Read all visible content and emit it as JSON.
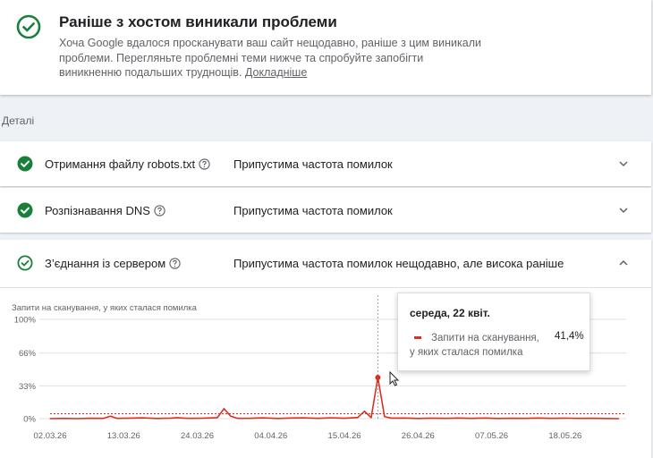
{
  "banner": {
    "title": "Раніше з хостом виникали проблеми",
    "text": "Хоча Google вдалося просканувати ваш сайт нещодавно, раніше з цим виникали проблеми. Перегляньте проблемні теми нижче та спробуйте запобігти виникненню подальших труднощів.",
    "link": "Докладніше",
    "icon": "check-circle-icon",
    "accent_color": "#188038"
  },
  "details_label": "Деталі",
  "rows": [
    {
      "name": "Отримання файлу robots.txt",
      "status": "Припустима частота помилок",
      "expanded": false
    },
    {
      "name": "Розпізнавання DNS",
      "status": "Припустима частота помилок",
      "expanded": false
    },
    {
      "name": "З’єднання із сервером",
      "status": "Припустима частота помилок нещодавно, але висока раніше",
      "expanded": true
    }
  ],
  "chart_label": "Запити на сканування, у яких сталася помилка",
  "tooltip": {
    "date": "середа, 22 квіт.",
    "series_name": "Запити на сканування, у яких сталася помилка",
    "value": "41,4%"
  },
  "chart_data": {
    "type": "line",
    "ylabel": "Запити на сканування, у яких сталася помилка",
    "y_ticks": [
      "100%",
      "66%",
      "33%",
      "0%"
    ],
    "y_tick_values": [
      100,
      66,
      33,
      0
    ],
    "ylim": [
      0,
      100
    ],
    "x_ticks": [
      "02.03.26",
      "13.03.26",
      "24.03.26",
      "04.04.26",
      "15.04.26",
      "26.04.26",
      "07.05.26",
      "18.05.26"
    ],
    "x_tick_days": [
      0,
      11,
      22,
      33,
      44,
      55,
      66,
      77
    ],
    "threshold_percent": 5,
    "grid": true,
    "series": [
      {
        "color": "#d93025",
        "points": [
          {
            "day": 0,
            "value": 0
          },
          {
            "day": 2,
            "value": 0.3
          },
          {
            "day": 4,
            "value": 0
          },
          {
            "day": 6,
            "value": 0.4
          },
          {
            "day": 8,
            "value": 0.3
          },
          {
            "day": 9,
            "value": 2.5
          },
          {
            "day": 10,
            "value": 0.3
          },
          {
            "day": 12,
            "value": 0.5
          },
          {
            "day": 14,
            "value": 0.8
          },
          {
            "day": 16,
            "value": 0.2
          },
          {
            "day": 18,
            "value": 0.5
          },
          {
            "day": 19,
            "value": 1
          },
          {
            "day": 20,
            "value": 0.5
          },
          {
            "day": 21,
            "value": 0.3
          },
          {
            "day": 23,
            "value": 0.5
          },
          {
            "day": 25,
            "value": 1
          },
          {
            "day": 26,
            "value": 10
          },
          {
            "day": 27,
            "value": 2.5
          },
          {
            "day": 28,
            "value": 0.3
          },
          {
            "day": 30,
            "value": 0.4
          },
          {
            "day": 32,
            "value": 0.8
          },
          {
            "day": 34,
            "value": 0.2
          },
          {
            "day": 36,
            "value": 0.6
          },
          {
            "day": 38,
            "value": 0.8
          },
          {
            "day": 40,
            "value": 0.3
          },
          {
            "day": 42,
            "value": 0.9
          },
          {
            "day": 44,
            "value": 0.4
          },
          {
            "day": 46,
            "value": 1.2
          },
          {
            "day": 47,
            "value": 7.5
          },
          {
            "day": 48,
            "value": 1
          },
          {
            "day": 49,
            "value": 41.4
          },
          {
            "day": 50,
            "value": 2
          },
          {
            "day": 51,
            "value": 0.5
          },
          {
            "day": 53,
            "value": 0.6
          },
          {
            "day": 55,
            "value": 0.2
          },
          {
            "day": 57,
            "value": 0.5
          },
          {
            "day": 59,
            "value": 0.3
          },
          {
            "day": 61,
            "value": 0.6
          },
          {
            "day": 63,
            "value": 0.3
          },
          {
            "day": 65,
            "value": 0.6
          },
          {
            "day": 67,
            "value": 0.2
          },
          {
            "day": 69,
            "value": 0.4
          },
          {
            "day": 71,
            "value": 0.3
          },
          {
            "day": 73,
            "value": 0.6
          },
          {
            "day": 75,
            "value": 0.3
          },
          {
            "day": 77,
            "value": 0.5
          },
          {
            "day": 79,
            "value": 0.3
          },
          {
            "day": 81,
            "value": 0.4
          },
          {
            "day": 83,
            "value": 0.2
          },
          {
            "day": 85,
            "value": 0
          }
        ]
      }
    ],
    "hover_day": 49
  }
}
